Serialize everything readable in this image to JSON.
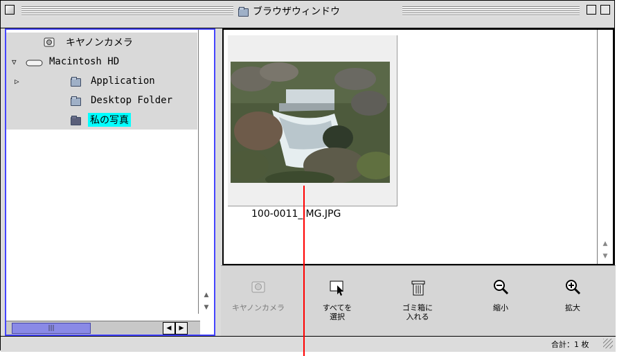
{
  "window": {
    "title": "ブラウザウィンドウ"
  },
  "tree": {
    "items": [
      {
        "label": "キヤノンカメラ",
        "icon": "camera-icon"
      },
      {
        "label": "Macintosh HD",
        "icon": "harddisk-icon",
        "expanded": true
      },
      {
        "label": "Application",
        "icon": "folder-icon",
        "expanded": false
      },
      {
        "label": "Desktop Folder",
        "icon": "folder-icon"
      },
      {
        "label": "私の写真",
        "icon": "folder-dark-icon",
        "selected": true
      }
    ]
  },
  "content": {
    "filename": "100-0011_IMG.JPG"
  },
  "toolbar": {
    "camera_label": "キヤノンカメラ",
    "select_all_label_1": "すべてを",
    "select_all_label_2": "選択",
    "trash_label_1": "ゴミ箱に",
    "trash_label_2": "入れる",
    "zoom_out_label": "縮小",
    "zoom_in_label": "拡大"
  },
  "status": {
    "total": "合計：1 枚"
  },
  "colors": {
    "accent": "#4444ff",
    "selection": "#00ffff",
    "pointer": "#ff0000"
  }
}
